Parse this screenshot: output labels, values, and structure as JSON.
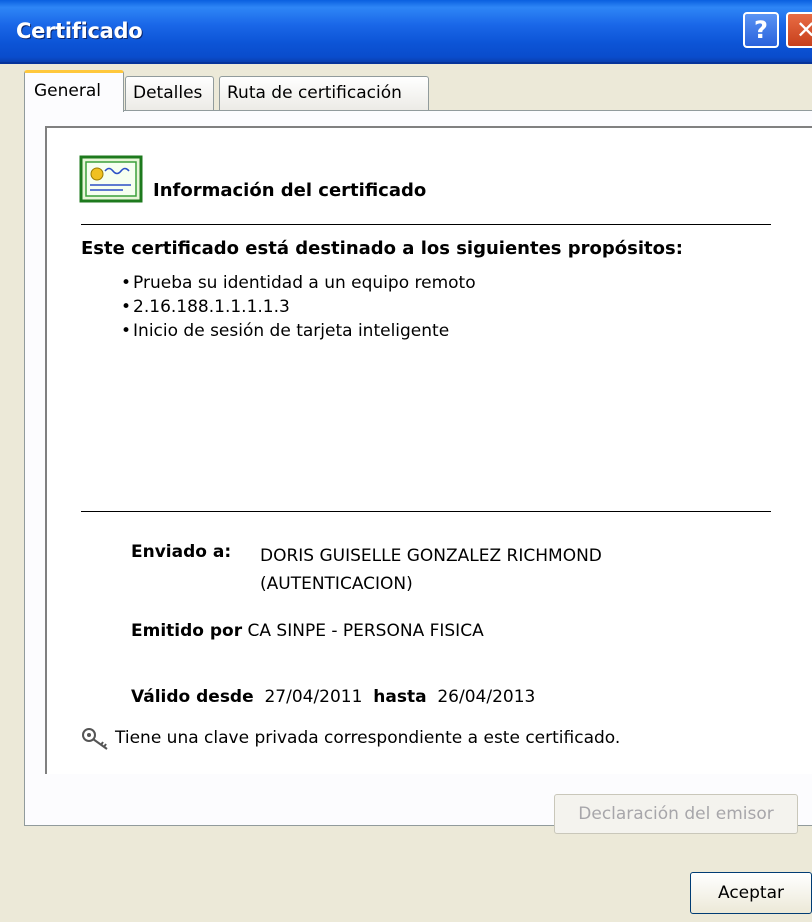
{
  "window": {
    "title": "Certificado",
    "help_glyph": "?",
    "close_glyph": "✕"
  },
  "tabs": [
    {
      "label": "General",
      "active": true
    },
    {
      "label": "Detalles",
      "active": false
    },
    {
      "label": "Ruta de certificación",
      "active": false
    }
  ],
  "general": {
    "heading": "Información del certificado",
    "purposes_title": "Este certificado está destinado a los siguientes propósitos:",
    "bullet": "•",
    "purposes": [
      "Prueba su identidad a un equipo remoto",
      "2.16.188.1.1.1.1.3",
      "Inicio de sesión de tarjeta inteligente"
    ],
    "issued_to_label": "Enviado a:",
    "issued_to_line1": "DORIS GUISELLE GONZALEZ RICHMOND",
    "issued_to_line2": "(AUTENTICACION)",
    "issued_by_label": "Emitido por",
    "issued_by_value": "CA SINPE - PERSONA FISICA",
    "valid_from_label": "Válido desde",
    "valid_from_value": "27/04/2011",
    "valid_to_label": "hasta",
    "valid_to_value": "26/04/2013",
    "private_key_note": "Tiene una clave privada correspondiente a este certificado."
  },
  "buttons": {
    "issuer_statement": "Declaración del emisor",
    "ok": "Aceptar"
  },
  "icons": {
    "certificate": "certificate-icon",
    "key": "key-icon"
  },
  "colors": {
    "titlebar": "#0a4ccc",
    "face": "#ece9d8",
    "active_tab_accent": "#ffc83c",
    "disabled_text": "#a7a6aa"
  }
}
